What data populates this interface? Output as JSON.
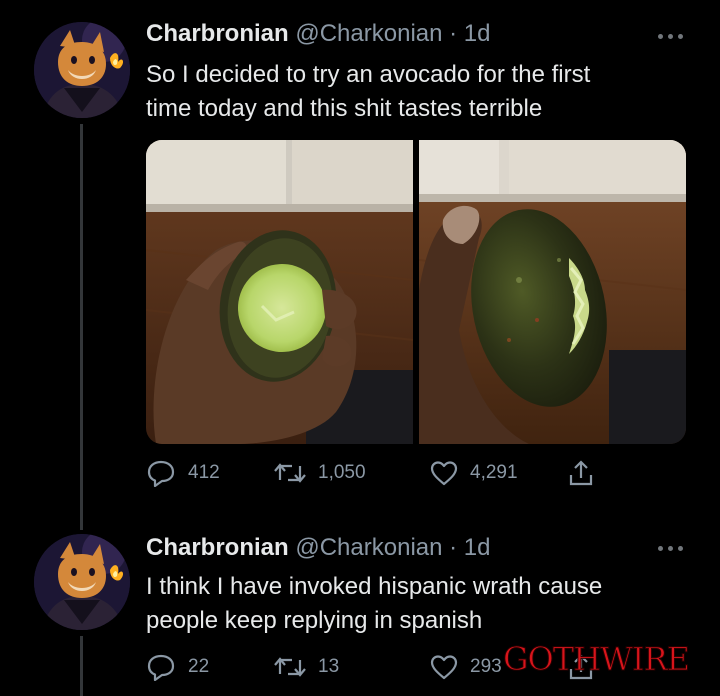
{
  "tweets": [
    {
      "display_name": "Charbronian",
      "handle": "@Charkonian",
      "time": "· 1d",
      "text_lines": [
        "So I decided to try an avocado for the first",
        "time today and this shit tastes terrible"
      ],
      "replies": "412",
      "retweets": "1,050",
      "likes": "4,291"
    },
    {
      "display_name": "Charbronian",
      "handle": "@Charkonian",
      "time": "· 1d",
      "text_lines": [
        "I think I have invoked hispanic wrath cause",
        "people keep replying in spanish"
      ],
      "replies": "22",
      "retweets": "13",
      "likes": "293"
    }
  ],
  "watermark": "GOTHWIRE",
  "colors": {
    "background": "#000000",
    "text": "#e7e9ea",
    "muted": "#8b98a5",
    "watermark": "#d8141b"
  },
  "icons": [
    "reply-icon",
    "retweet-icon",
    "like-icon",
    "share-icon",
    "more-icon"
  ]
}
